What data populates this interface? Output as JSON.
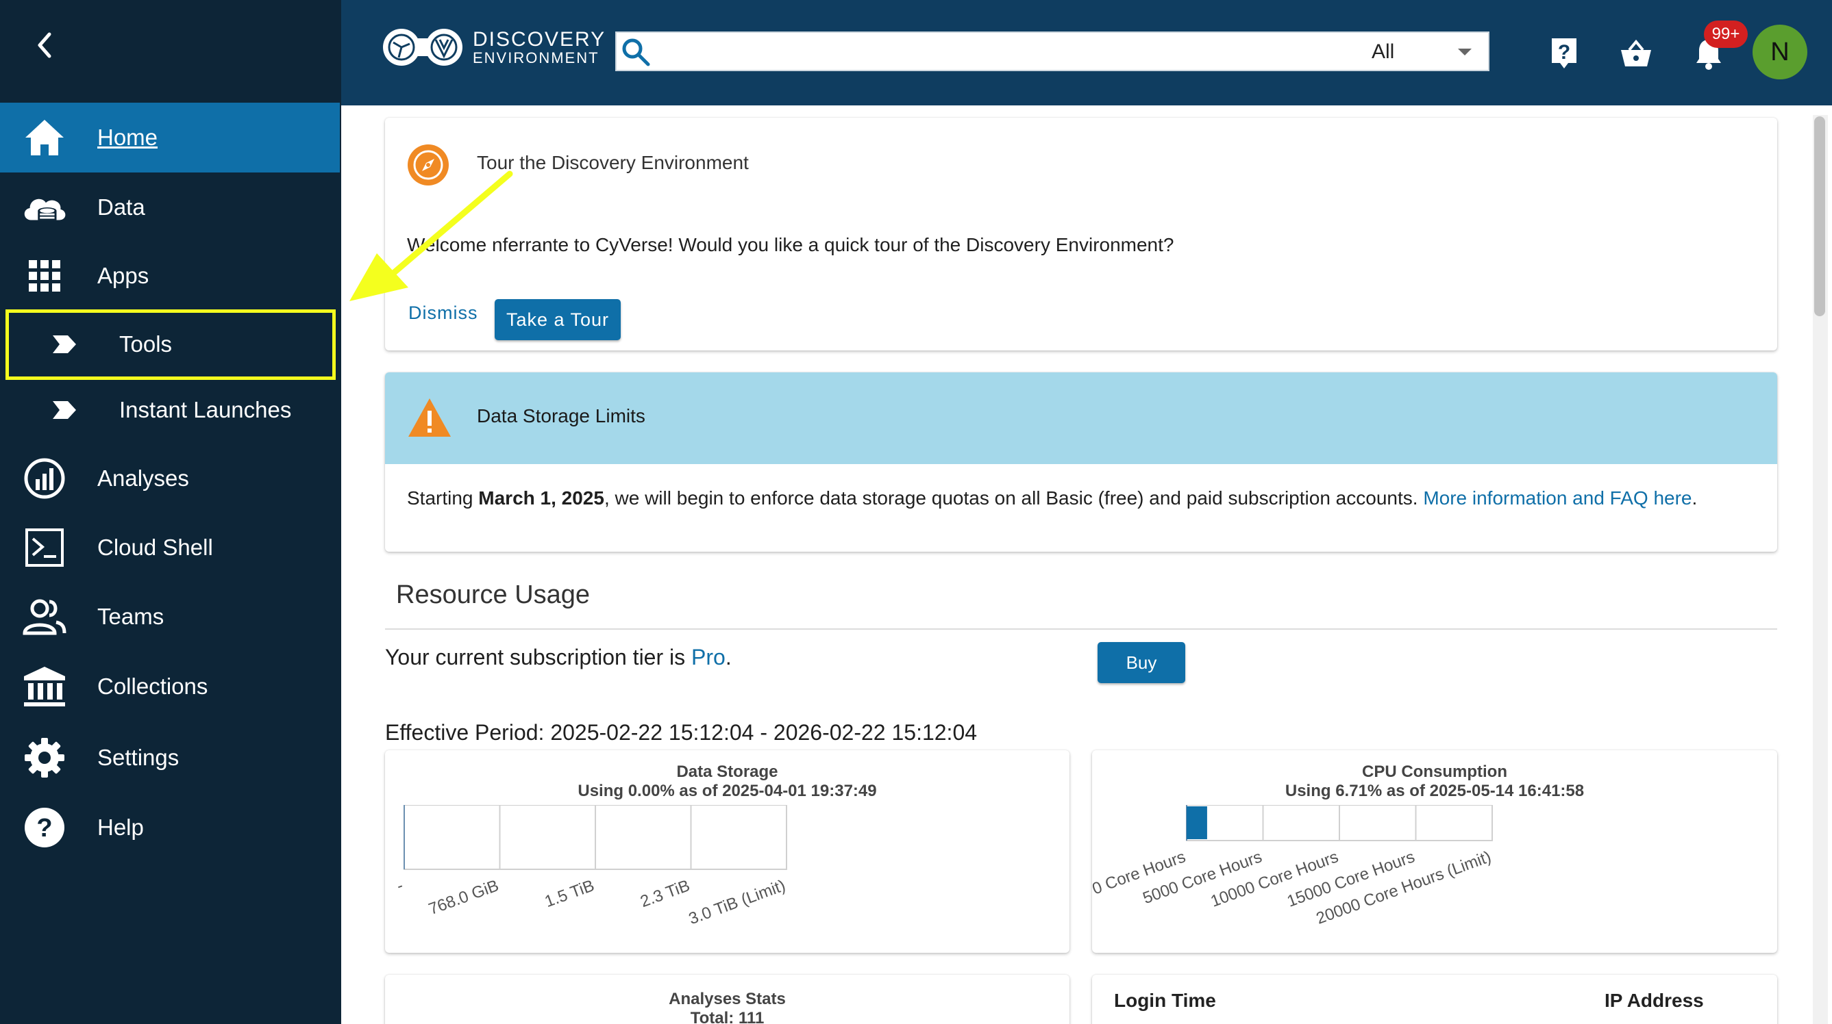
{
  "sidebar": {
    "items": [
      {
        "label": "Home",
        "icon": "home-icon"
      },
      {
        "label": "Data",
        "icon": "cloud-database-icon"
      },
      {
        "label": "Apps",
        "icon": "grid-icon"
      },
      {
        "label": "Tools",
        "icon": "chevron-tag-icon"
      },
      {
        "label": "Instant Launches",
        "icon": "chevron-tag-icon"
      },
      {
        "label": "Analyses",
        "icon": "gauge-icon"
      },
      {
        "label": "Cloud Shell",
        "icon": "terminal-icon"
      },
      {
        "label": "Teams",
        "icon": "people-icon"
      },
      {
        "label": "Collections",
        "icon": "bank-icon"
      },
      {
        "label": "Settings",
        "icon": "gear-icon"
      },
      {
        "label": "Help",
        "icon": "help-icon"
      }
    ],
    "highlight_color": "#f4ff1e"
  },
  "header": {
    "logo_line1": "DISCOVERY",
    "logo_line2": "ENVIRONMENT",
    "search_placeholder": "",
    "search_filter": "All",
    "notification_badge": "99+",
    "avatar_initial": "N"
  },
  "tour": {
    "title": "Tour the Discovery Environment",
    "body": "Welcome nferrante to CyVerse! Would you like a quick tour of the Discovery Environment?",
    "dismiss_label": "Dismiss",
    "tour_label": "Take a Tour"
  },
  "storage_notice": {
    "title": "Data Storage Limits",
    "body_prefix": "Starting ",
    "body_date": "March 1, 2025",
    "body_mid": ", we will begin to enforce data storage quotas on all Basic (free) and paid subscription accounts. ",
    "link_text": "More information and FAQ here",
    "body_suffix": "."
  },
  "resource_usage": {
    "title": "Resource Usage",
    "tier_prefix": "Your current subscription tier is ",
    "tier_name": "Pro",
    "tier_suffix": ".",
    "buy_label": "Buy",
    "period": "Effective Period: 2025-02-22 15:12:04 - 2026-02-22 15:12:04"
  },
  "chart_data": [
    {
      "type": "bar",
      "title": "Data Storage",
      "subtitle": "Using 0.00% as of 2025-04-01 19:37:49",
      "orientation": "horizontal",
      "ticks": [
        "-",
        "768.0 GiB",
        "1.5 TiB",
        "2.3 TiB",
        "3.0 TiB (Limit)"
      ],
      "values": [
        0.0
      ],
      "xlim": [
        0,
        100
      ],
      "grid": true,
      "color": "#0f6fa8"
    },
    {
      "type": "bar",
      "title": "CPU Consumption",
      "subtitle": "Using 6.71% as of 2025-05-14 16:41:58",
      "orientation": "horizontal",
      "ticks": [
        "0 Core Hours",
        "5000 Core Hours",
        "10000 Core Hours",
        "15000 Core Hours",
        "20000 Core Hours (Limit)"
      ],
      "values": [
        6.71
      ],
      "xlim": [
        0,
        100
      ],
      "grid": true,
      "color": "#0f6fa8"
    }
  ],
  "analyses_stats": {
    "title": "Analyses Stats",
    "total": "Total: 111"
  },
  "logins_table": {
    "columns": [
      "Login Time",
      "IP Address"
    ]
  }
}
